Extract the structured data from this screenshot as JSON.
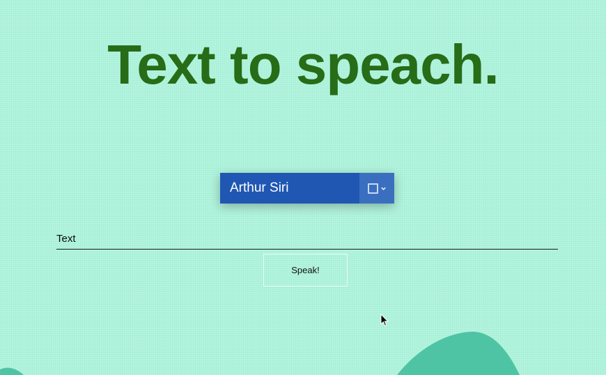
{
  "page": {
    "title": "Text to speach."
  },
  "voice_select": {
    "selected": "Arthur Siri",
    "icon": "square-icon",
    "toggle_icon": "chevron-down-icon"
  },
  "text_field": {
    "label": "Text",
    "value": ""
  },
  "speak_button": {
    "label": "Speak!"
  },
  "colors": {
    "background": "#b3f5df",
    "title": "#276c17",
    "select": "#1f57b3",
    "select_toggle": "#3a6fc0",
    "wave": "#4fc4a4"
  }
}
